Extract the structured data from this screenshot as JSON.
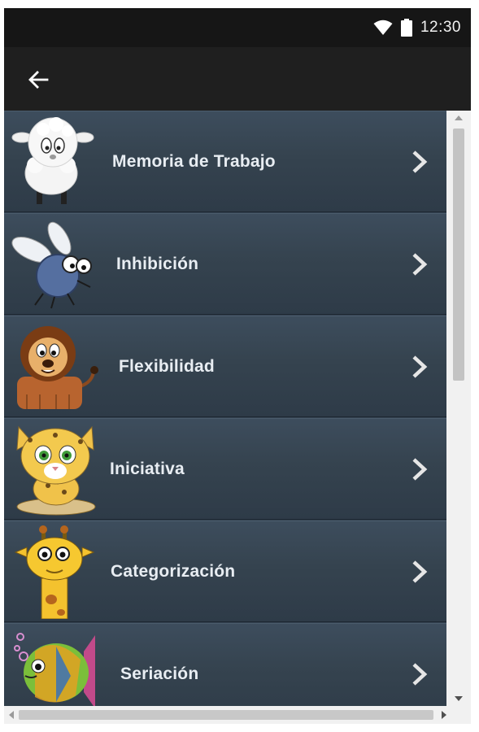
{
  "status_bar": {
    "time": "12:30",
    "icons": [
      "wifi-icon",
      "battery-icon"
    ]
  },
  "app_bar": {
    "back_icon": "back-arrow-icon"
  },
  "menu": {
    "items": [
      {
        "label": "Memoria de Trabajo",
        "icon": "sheep-icon"
      },
      {
        "label": "Inhibición",
        "icon": "fly-icon"
      },
      {
        "label": "Flexibilidad",
        "icon": "lion-icon"
      },
      {
        "label": "Iniciativa",
        "icon": "jaguar-icon"
      },
      {
        "label": "Categorización",
        "icon": "giraffe-icon"
      },
      {
        "label": "Seriación",
        "icon": "fish-icon"
      }
    ]
  },
  "colors": {
    "row_bg": "#35434f",
    "text": "#e8edf2",
    "status_bg": "#161616"
  }
}
